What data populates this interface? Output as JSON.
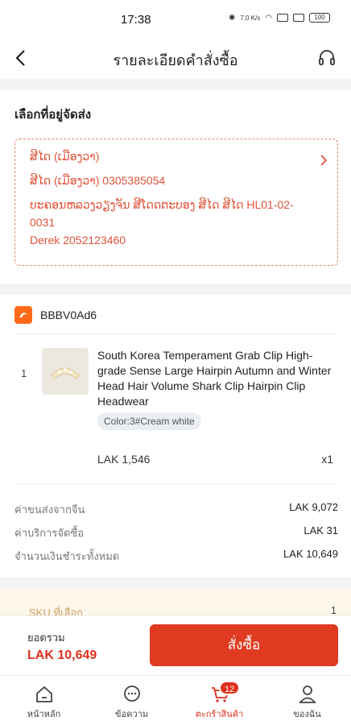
{
  "status_bar": {
    "time": "17:38",
    "network_rate": "7.0 K/s",
    "battery": "100"
  },
  "header": {
    "title": "รายละเอียดคำสั่งซื้อ"
  },
  "address": {
    "heading": "เลือกที่อยู่จัดส่ง",
    "lines": [
      "ສີໄດ (ເມືອງວາ)",
      "ສີໄດ (ເມືອງວາ) 0305385054",
      "ບະຄອນຫລວງວຽງຈັນ ສີໂດດຕະບອງ ສີໄດ ສີໄດ HL01-02-",
      "0031",
      "Derek   2052123460"
    ]
  },
  "store": {
    "name": "BBBV0Ad6",
    "item": {
      "index": "1",
      "title": "South Korea Temperament Grab Clip High-grade Sense Large Hairpin Autumn and Winter Head Hair Volume Shark Clip Hairpin Clip Headwear",
      "variant": "Color:3#Cream white",
      "price": "LAK 1,546",
      "qty": "x1"
    },
    "fees": [
      {
        "label": "ค่าขนส่งจากจีน",
        "value": "LAK 9,072"
      },
      {
        "label": "ค่าบริการจัดซื้อ",
        "value": "LAK 31"
      },
      {
        "label": "จำนวนเงินชำระทั้งหมด",
        "value": "LAK 10,649"
      }
    ]
  },
  "sku": {
    "label": "SKU ที่เลือก",
    "value": "1"
  },
  "order_bar": {
    "total_label": "ยอดรวม",
    "total_value": "LAK 10,649",
    "button_label": "สั่งซื้อ"
  },
  "nav": {
    "items": [
      {
        "label": "หน้าหลัก",
        "icon": "home-icon"
      },
      {
        "label": "ข้อความ",
        "icon": "chat-icon"
      },
      {
        "label": "ตะกร้าสินค้า",
        "icon": "cart-icon"
      },
      {
        "label": "ของฉัน",
        "icon": "profile-icon"
      }
    ],
    "cart_badge": "12"
  },
  "colors": {
    "accent": "#e03a21",
    "address_text": "#e0533a"
  }
}
